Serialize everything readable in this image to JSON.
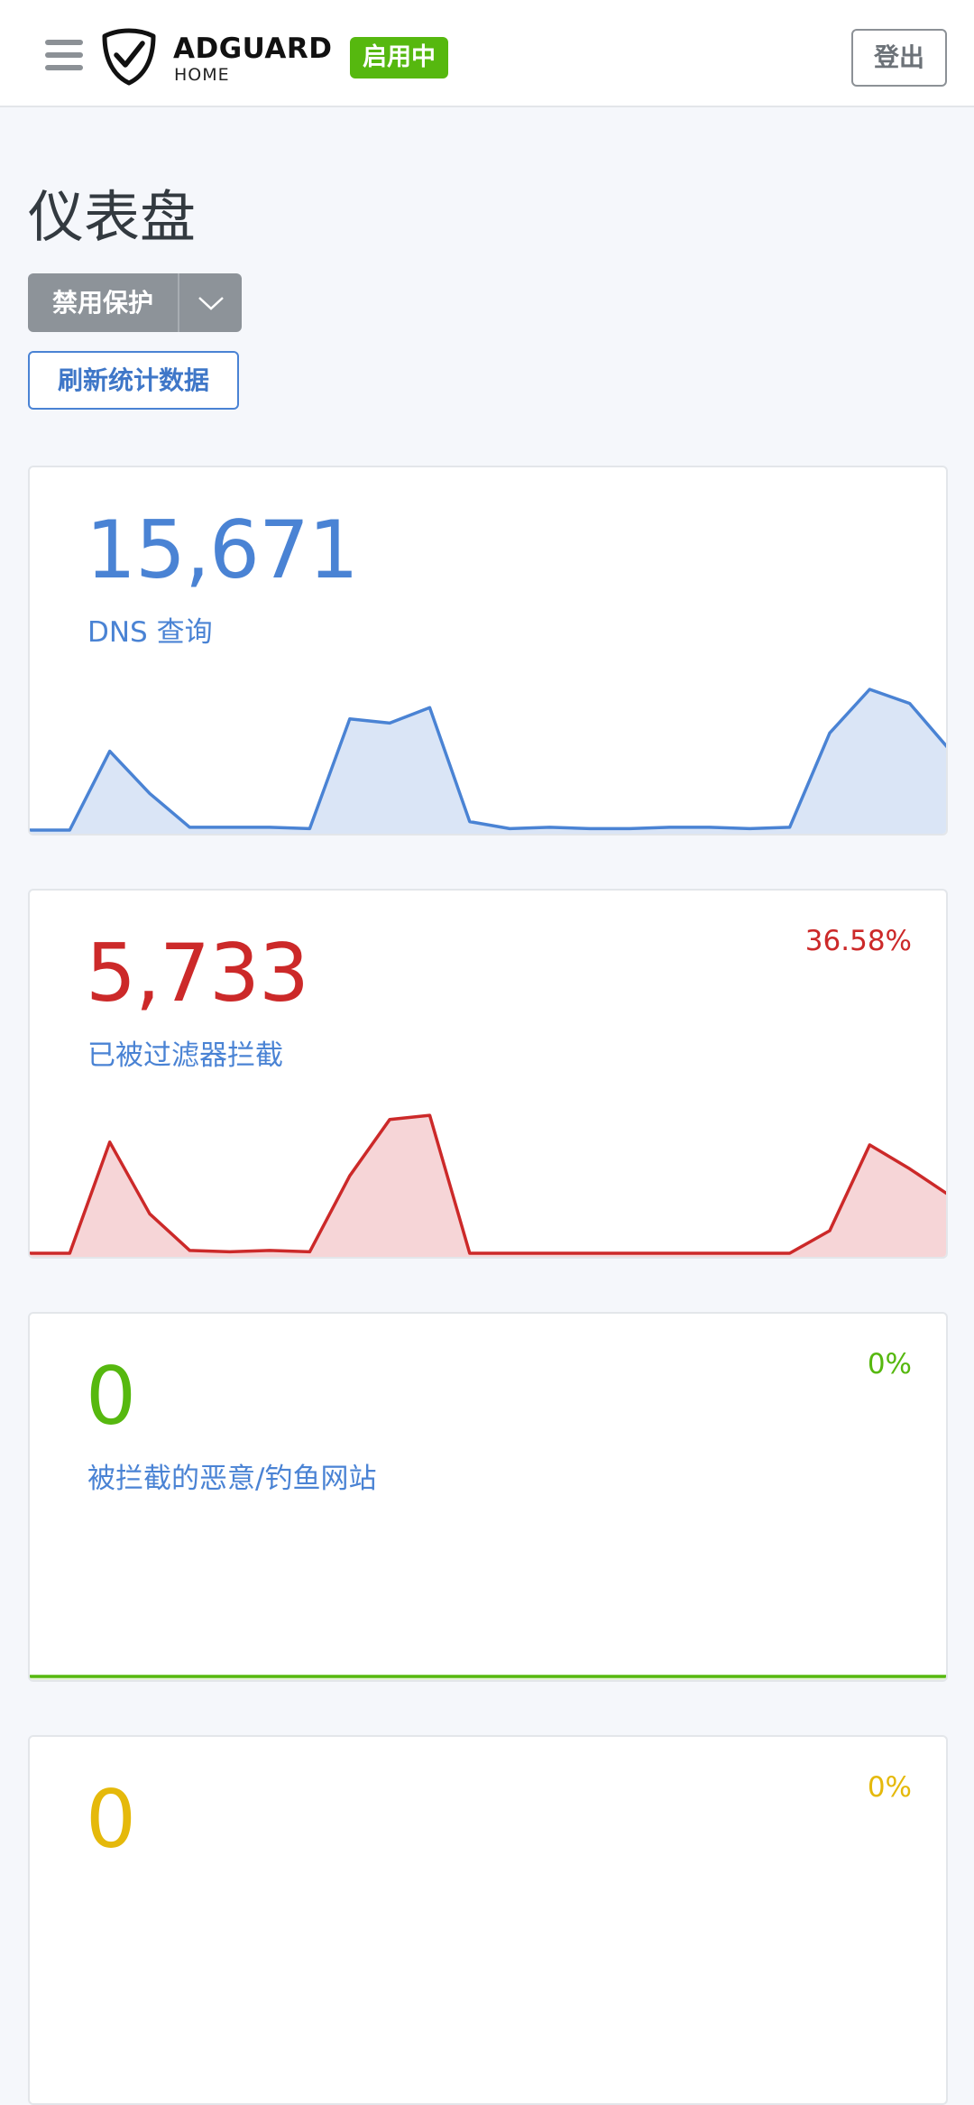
{
  "header": {
    "brand": "ADGUARD",
    "brand_sub": "HOME",
    "status": "启用中",
    "logout_label": "登出"
  },
  "page": {
    "title": "仪表盘",
    "disable_protection_label": "禁用保护",
    "refresh_label": "刷新统计数据"
  },
  "colors": {
    "blue": "#4a83d4",
    "red": "#cc2929",
    "green": "#56b80f",
    "yellow": "#e5b90b"
  },
  "cards": [
    {
      "value": "15,671",
      "label": "DNS 查询",
      "percent": "",
      "color": "#4a83d4",
      "fill": "#dae5f6",
      "series": [
        0,
        0,
        56,
        26,
        2,
        2,
        2,
        1,
        79,
        76,
        87,
        6,
        1,
        2,
        1,
        1,
        2,
        2,
        1,
        2,
        69,
        100,
        90,
        57
      ]
    },
    {
      "value": "5,733",
      "label": "已被过滤器拦截",
      "percent": "36.58%",
      "color": "#cc2929",
      "fill": "#f6d5d7",
      "series": [
        0,
        0,
        79,
        28,
        2,
        1,
        2,
        1,
        55,
        95,
        98,
        0,
        0,
        0,
        0,
        0,
        0,
        0,
        0,
        0,
        16,
        77,
        60,
        41
      ]
    },
    {
      "value": "0",
      "label": "被拦截的恶意/钓鱼网站",
      "percent": "0%",
      "color": "#56b80f",
      "fill": "#e3f2d6",
      "series": [
        0,
        0,
        0,
        0,
        0,
        0,
        0,
        0,
        0,
        0,
        0,
        0,
        0,
        0,
        0,
        0,
        0,
        0,
        0,
        0,
        0,
        0,
        0,
        0
      ]
    },
    {
      "value": "0",
      "label": "",
      "percent": "0%",
      "color": "#e5b90b",
      "fill": "#fbf1cf",
      "series": []
    }
  ]
}
